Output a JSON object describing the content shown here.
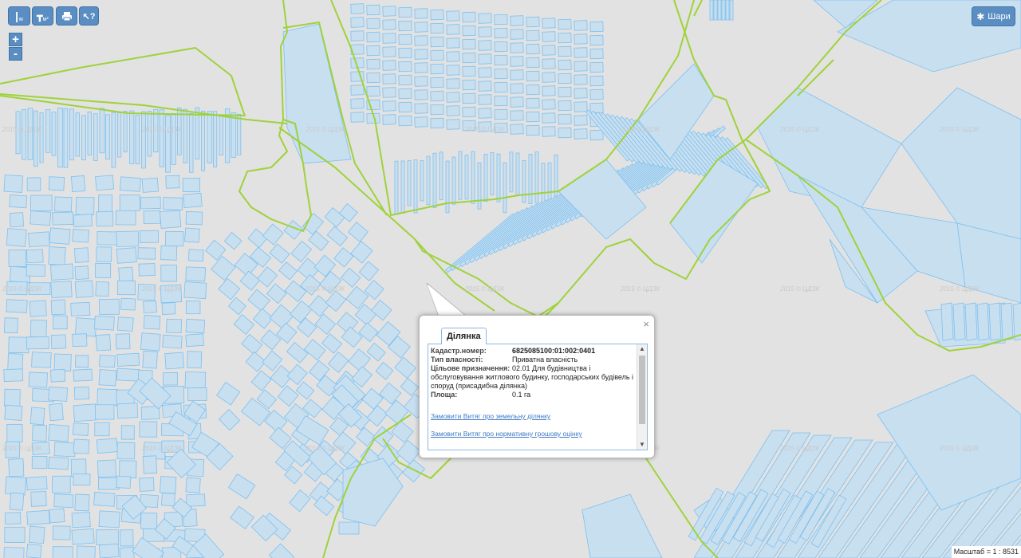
{
  "toolbar": {
    "measure_length_label": "м",
    "measure_area_label": "м²",
    "layers_label": "Шари"
  },
  "zoom": {
    "in_label": "+",
    "out_label": "-"
  },
  "watermark": "2015 © ЦДЗК",
  "popup": {
    "tab_label": "Ділянка",
    "close_label": "×",
    "fields": [
      {
        "label": "Кадастр.номер:",
        "value": "6825085100:01:002:0401"
      },
      {
        "label": "Тип власності:",
        "value": "Приватна власність"
      },
      {
        "label": "Цільове призначення:",
        "value": "02.01 Для будівництва і"
      }
    ],
    "purpose_continued": "обслуговування житлового будинку, господарських будівель і споруд (присадибна ділянка)",
    "area_label": "Площа:",
    "area_value": "0.1 га",
    "link_extract": "Замовити Витяг про земельну ділянку",
    "link_valuation": "Замовити Витяг про нормативну грошову оцінку"
  },
  "scale": {
    "label": "Масштаб = 1 : 8531"
  },
  "colors": {
    "background": "#e2e2e2",
    "parcel_fill": "#c8dff0",
    "parcel_stroke": "#7ec0ee",
    "boundary": "#9fd23a",
    "toolbar": "#5a8ec3"
  }
}
